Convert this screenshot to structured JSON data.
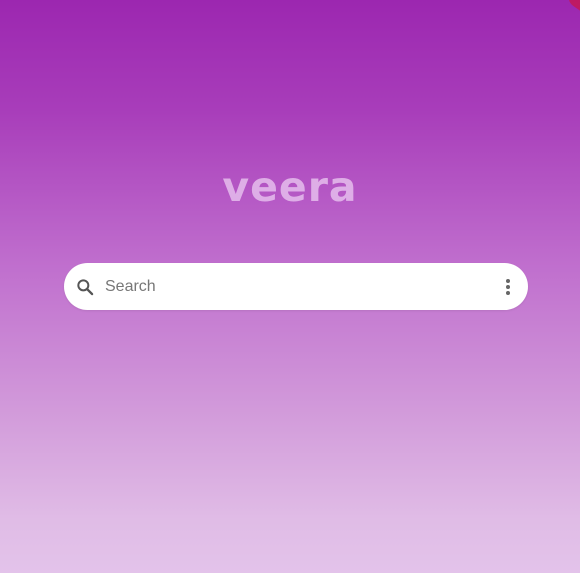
{
  "app": {
    "logo_text": "veera"
  },
  "search": {
    "placeholder": "Search",
    "value": "",
    "icon": "search-icon"
  },
  "menu": {
    "icon": "more-vertical-icon"
  },
  "colors": {
    "background_top": "#9c27b0",
    "background_bottom": "#e3c3ea",
    "logo": "#e2b6ea",
    "search_bar": "#ffffff",
    "icon": "#555555"
  }
}
